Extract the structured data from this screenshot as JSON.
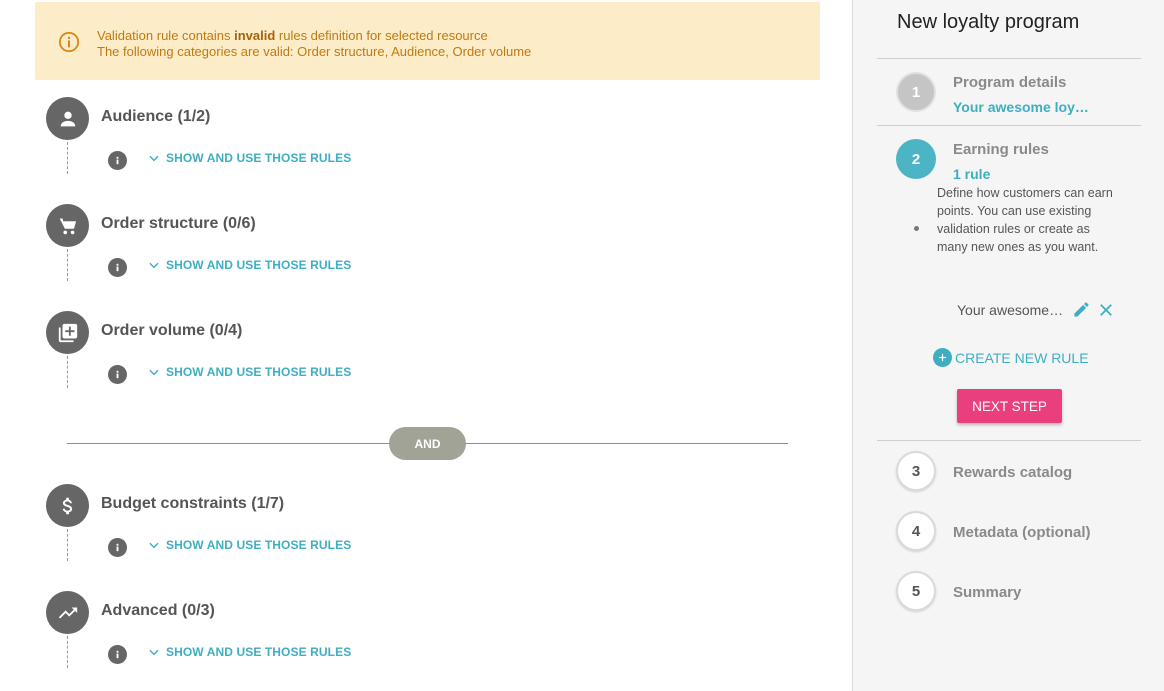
{
  "alert": {
    "line1_before": "Validation rule contains",
    "line1_bold": "invalid",
    "line1_after": "rules definition for selected resource",
    "line2": "The following categories are valid: Order structure, Audience, Order volume",
    "color": "#c07a10",
    "background": "#fdecc8"
  },
  "sections": [
    {
      "title": "Audience (1/2)",
      "icon": "person-icon",
      "toggle": "SHOW AND USE THOSE RULES"
    },
    {
      "title": "Order structure (0/6)",
      "icon": "cart-icon",
      "toggle": "SHOW AND USE THOSE RULES"
    },
    {
      "title": "Order volume (0/4)",
      "icon": "library-add-icon",
      "toggle": "SHOW AND USE THOSE RULES"
    },
    {
      "title": "Budget constraints (1/7)",
      "icon": "dollar-icon",
      "toggle": "SHOW AND USE THOSE RULES"
    },
    {
      "title": "Advanced (0/3)",
      "icon": "trending-up-icon",
      "toggle": "SHOW AND USE THOSE RULES"
    }
  ],
  "and_label": "AND",
  "sidebar": {
    "title": "New loyalty program",
    "steps": [
      {
        "number": "1",
        "label": "Program details",
        "sub": "Your awesome loy…",
        "state": "done"
      },
      {
        "number": "2",
        "label": "Earning rules",
        "sub": "1 rule",
        "state": "active",
        "description": "Define how customers can earn points. You can use existing validation rules or create as many new ones as you want."
      },
      {
        "number": "3",
        "label": "Rewards catalog",
        "state": "todo"
      },
      {
        "number": "4",
        "label": "Metadata (optional)",
        "state": "todo"
      },
      {
        "number": "5",
        "label": "Summary",
        "state": "todo"
      }
    ],
    "rule_name": "Your awesome…",
    "create_rule_label": "CREATE NEW RULE",
    "next_step_label": "NEXT STEP"
  },
  "colors": {
    "accent": "#3eaec2",
    "primary_button": "#ea3f7f",
    "and_pill": "#a0a396"
  }
}
